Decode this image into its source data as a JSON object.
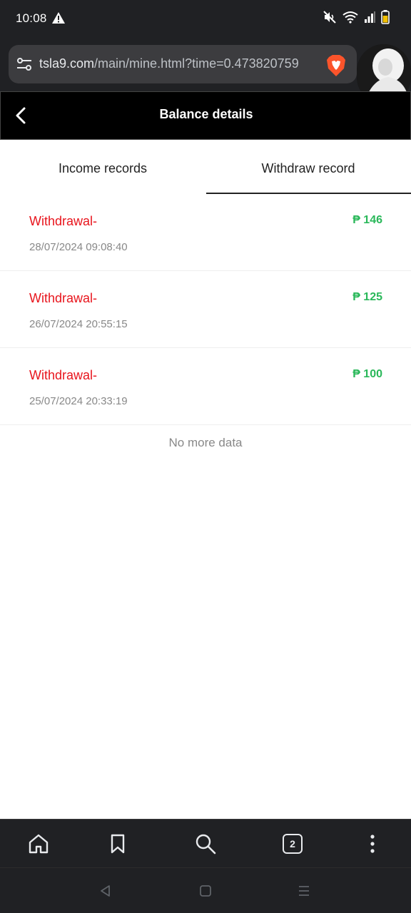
{
  "status_bar": {
    "time": "10:08",
    "icons": [
      "warning-icon",
      "mute-icon",
      "wifi-icon",
      "signal-icon",
      "battery-icon"
    ]
  },
  "browser": {
    "url_domain": "tsla9.com",
    "url_path": "/main/mine.html?time=0.473820759",
    "tab_count": "2"
  },
  "header": {
    "title": "Balance details"
  },
  "tabs": [
    {
      "label": "Income records",
      "active": false
    },
    {
      "label": "Withdraw record",
      "active": true
    }
  ],
  "records": [
    {
      "label": "Withdrawal-",
      "amount": "₱ 146",
      "time": "28/07/2024 09:08:40"
    },
    {
      "label": "Withdrawal-",
      "amount": "₱ 125",
      "time": "26/07/2024 20:55:15"
    },
    {
      "label": "Withdrawal-",
      "amount": "₱ 100",
      "time": "25/07/2024 20:33:19"
    }
  ],
  "footer_note": "No more data",
  "colors": {
    "withdrawal_label": "#e8141c",
    "amount": "#2ab85a",
    "header_bg": "#000000",
    "browser_bg": "#202124"
  }
}
